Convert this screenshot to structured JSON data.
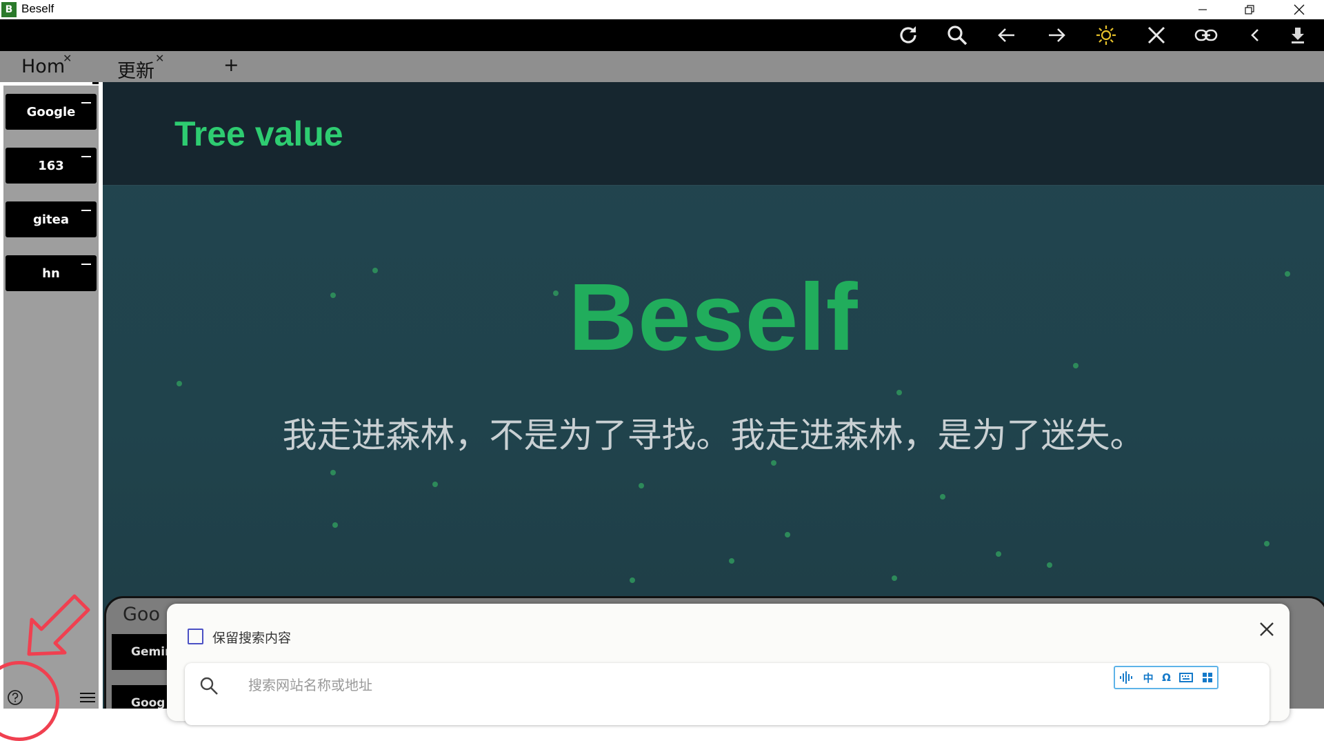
{
  "window": {
    "title": "Beself",
    "icon_letter": "B",
    "controls": [
      "minimize-icon",
      "restore-icon",
      "close-icon"
    ]
  },
  "toolbar": {
    "icons": [
      "refresh-icon",
      "search-icon",
      "back-arrow-icon",
      "forward-arrow-icon",
      "sun-icon",
      "close-x-icon",
      "link-icon",
      "chevron-left-icon",
      "download-icon"
    ],
    "sun_color": "#e6c12a"
  },
  "tabs": [
    {
      "label": "Hom",
      "active": false
    },
    {
      "label": "更新",
      "active": true
    }
  ],
  "new_tab_label": "+",
  "sidebar": {
    "bookmarks": [
      {
        "label": "Google"
      },
      {
        "label": "163"
      },
      {
        "label": "gitea"
      },
      {
        "label": "hn"
      }
    ]
  },
  "page": {
    "site_title": "Tree value",
    "hero_title": "Beself",
    "hero_subtitle": "我走进森林，不是为了寻找。我走进森林，是为了迷失。",
    "accent_color": "#2ecc71",
    "background_color": "#22444f"
  },
  "inner_panel": {
    "tab_label": "Goo",
    "buttons": [
      "Gemin",
      "Goog"
    ]
  },
  "dialog": {
    "checkbox_label": "保留搜索内容",
    "search_placeholder": "搜索网站名称或地址",
    "ime_items": [
      "中",
      "Ω"
    ]
  },
  "annotation": {
    "color": "#f04050"
  }
}
